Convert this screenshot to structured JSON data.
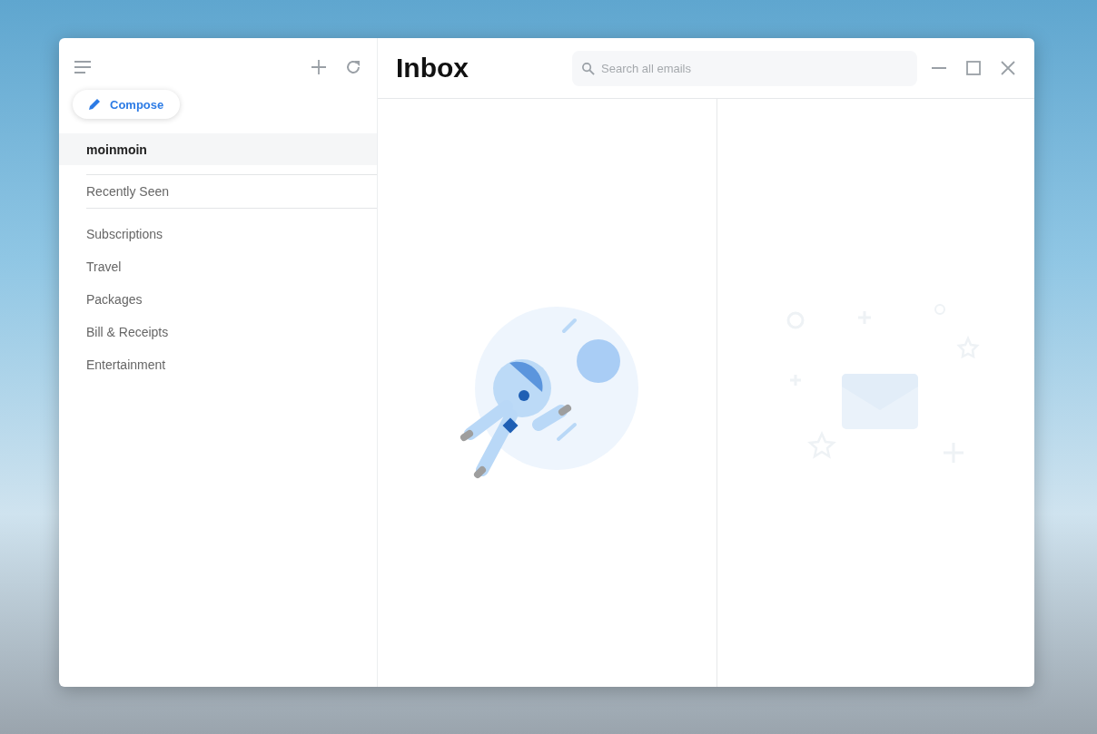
{
  "window": {
    "title": "Inbox",
    "search": {
      "placeholder": "Search all emails"
    }
  },
  "sidebar": {
    "compose": {
      "label": "Compose"
    },
    "account": {
      "label": "moinmoin",
      "selected": true
    },
    "views": [
      {
        "label": "Recently Seen",
        "selected": false
      }
    ],
    "folders": [
      {
        "label": "Subscriptions",
        "selected": false
      },
      {
        "label": "Travel",
        "selected": false
      },
      {
        "label": "Packages",
        "selected": false
      },
      {
        "label": "Bill & Receipts",
        "selected": false
      },
      {
        "label": "Entertainment",
        "selected": false
      }
    ]
  }
}
